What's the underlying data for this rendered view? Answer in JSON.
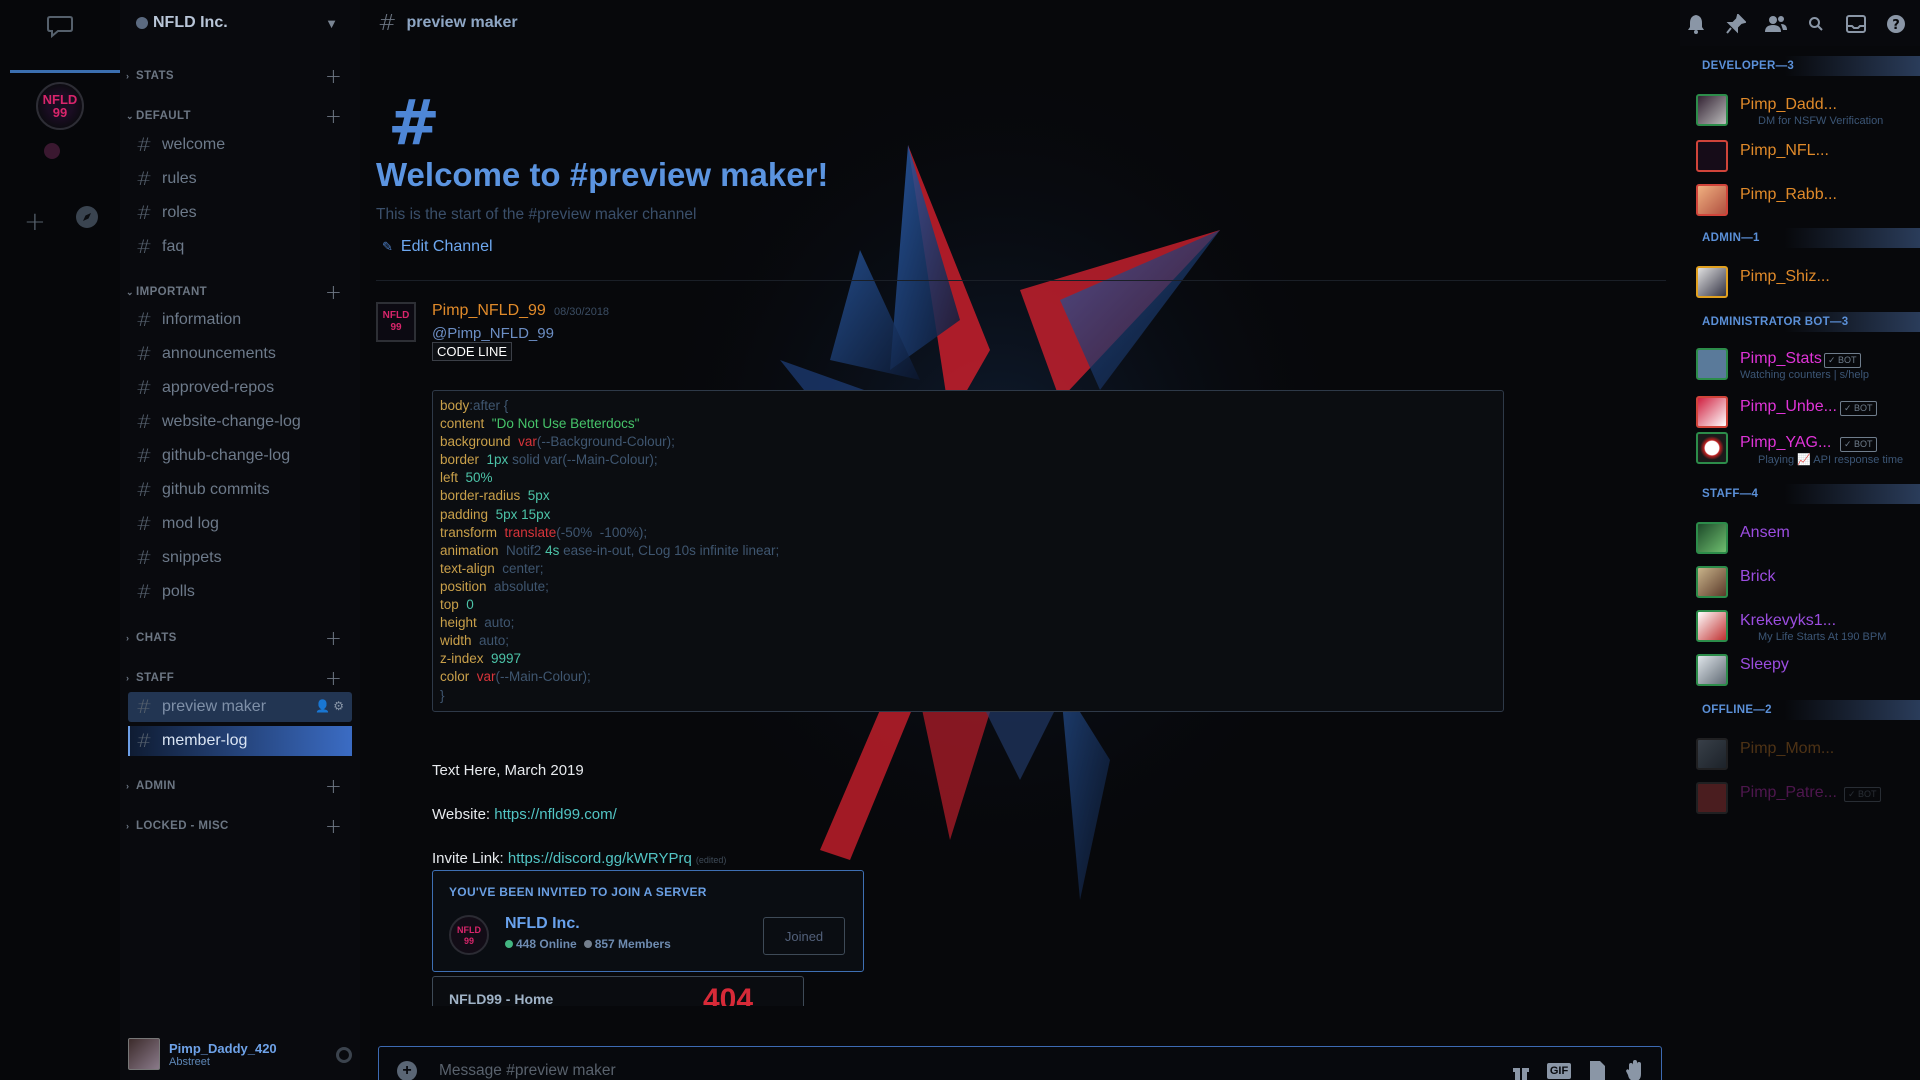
{
  "guild": {
    "name": "NFLD Inc."
  },
  "rail": {
    "server_avatar_text": "NFLD 99"
  },
  "sidebar": {
    "categories": [
      {
        "label": "STATS",
        "collapsed": true
      },
      {
        "label": "DEFAULT",
        "collapsed": false
      },
      {
        "label": "IMPORTANT",
        "collapsed": false
      },
      {
        "label": "CHATS",
        "collapsed": true
      },
      {
        "label": "STAFF",
        "collapsed": false
      },
      {
        "label": "ADMIN",
        "collapsed": true
      },
      {
        "label": "LOCKED - MISC",
        "collapsed": true
      }
    ],
    "default_channels": [
      "welcome",
      "rules",
      "roles",
      "faq"
    ],
    "important_channels": [
      "information",
      "announcements",
      "approved-repos",
      "website-change-log",
      "github-change-log",
      "github commits",
      "mod log",
      "snippets",
      "polls"
    ],
    "staff_channels": [
      "preview maker",
      "member-log"
    ]
  },
  "user": {
    "name": "Pimp_Daddy_420",
    "status": "Abstreet"
  },
  "topbar": {
    "channel": "preview maker"
  },
  "welcome": {
    "title": "Welcome to #preview maker!",
    "subtitle": "This is the start of the #preview maker channel",
    "edit": "Edit Channel"
  },
  "message": {
    "author": "Pimp_NFLD_99",
    "date": "08/30/2018",
    "mention": "@Pimp_NFLD_99",
    "code_label": "CODE LINE",
    "code_lines": [
      [
        "body",
        ":after {",
        "",
        ""
      ],
      [
        "content",
        "  \"Do Not Use Betterdocs\"",
        "",
        ""
      ],
      [
        "background",
        "  var",
        "(--Background-Colour);",
        ""
      ],
      [
        "border",
        "  1px",
        " solid ",
        "var(--Main-Colour);"
      ],
      [
        "left",
        "  50%",
        "",
        ""
      ],
      [
        "border-radius",
        "  5px",
        "",
        ""
      ],
      [
        "padding",
        "  5px 15px",
        "",
        ""
      ],
      [
        "transform",
        "  translate",
        "(-50%  -100%);",
        ""
      ],
      [
        "animation",
        "  Notif2 ",
        "4s",
        " ease-in-out, CLog 10s infinite linear;"
      ],
      [
        "text-align",
        "  center;",
        "",
        ""
      ],
      [
        "position",
        "  absolute;",
        "",
        ""
      ],
      [
        "top",
        "  0",
        "",
        ""
      ],
      [
        "height",
        "  auto;",
        "",
        ""
      ],
      [
        "width",
        "  auto;",
        "",
        ""
      ],
      [
        "z-index",
        "  9997",
        "",
        ""
      ],
      [
        "color",
        "  var",
        "(--Main-Colour);",
        ""
      ],
      [
        "}",
        "",
        "",
        ""
      ]
    ],
    "text1": "Text Here, March 2019",
    "website_label": "Website: ",
    "website_url": "https://nfld99.com/",
    "invite_label": "Invite Link: ",
    "invite_url": "https://discord.gg/kWRYPrq",
    "edited": "(edited)"
  },
  "invite": {
    "heading": "YOU'VE BEEN INVITED TO JOIN A SERVER",
    "server": "NFLD Inc.",
    "online": "448 Online",
    "members": "857 Members",
    "button": "Joined",
    "icon_text": "NFLD 99"
  },
  "embed2": {
    "text": "NFLD99 - Home",
    "number": "404"
  },
  "composer": {
    "placeholder": "Message #preview maker",
    "icons": [
      "gift-icon",
      "gif-icon",
      "file-icon",
      "emoji-icon"
    ]
  },
  "members": {
    "roles": [
      {
        "label": "DEVELOPER—3"
      },
      {
        "label": "ADMIN—1"
      },
      {
        "label": "ADMINISTRATOR BOT—3"
      },
      {
        "label": "STAFF—4"
      },
      {
        "label": "OFFLINE—2"
      }
    ],
    "list": [
      {
        "name": "Pimp_Dadd...",
        "status": "DM for NSFW Verification",
        "color": "#e08a2a"
      },
      {
        "name": "Pimp_NFL...",
        "status": "",
        "color": "#e08a2a"
      },
      {
        "name": "Pimp_Rabb...",
        "status": "",
        "color": "#e08a2a"
      },
      {
        "name": "Pimp_Shiz...",
        "status": "",
        "color": "#e08a2a"
      },
      {
        "name": "Pimp_Stats",
        "status": "Watching counters | s/help",
        "color": "#e034d8",
        "bot": "✓ BOT"
      },
      {
        "name": "Pimp_Unbe...",
        "status": "",
        "color": "#e034d8",
        "bot": "✓ BOT"
      },
      {
        "name": "Pimp_YAG...",
        "status": "Playing 📈 API response time",
        "color": "#e034d8",
        "bot": "✓ BOT"
      },
      {
        "name": "Ansem",
        "status": "",
        "color": "#9b4de0"
      },
      {
        "name": "Brick",
        "status": "",
        "color": "#9b4de0"
      },
      {
        "name": "Krekevyks1...",
        "status": "My Life Starts At 190 BPM",
        "color": "#9b4de0"
      },
      {
        "name": "Sleepy",
        "status": "",
        "color": "#9b4de0"
      },
      {
        "name": "Pimp_Mom...",
        "status": "",
        "color": "#e08a2a"
      },
      {
        "name": "Pimp_Patre...",
        "status": "",
        "color": "#e034d8",
        "bot": "✓ BOT"
      }
    ]
  },
  "colors": {
    "accent": "#3b6fb0",
    "link": "#52c5c5",
    "owner": "#e08a2a",
    "bot": "#e034d8",
    "staff": "#9b4de0"
  }
}
